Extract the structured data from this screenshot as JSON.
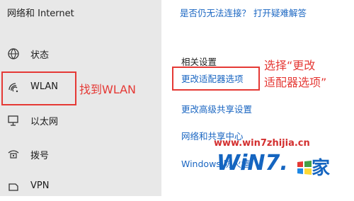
{
  "sidebar": {
    "title": "网络和 Internet",
    "items": [
      {
        "label": "状态",
        "icon": "globe-icon"
      },
      {
        "label": "WLAN",
        "icon": "wifi-icon"
      },
      {
        "label": "以太网",
        "icon": "ethernet-icon"
      },
      {
        "label": "拨号",
        "icon": "dialup-icon"
      },
      {
        "label": "VPN",
        "icon": "vpn-icon"
      }
    ]
  },
  "main": {
    "help_link": "是否仍无法连接？ 打开疑难解答",
    "related_heading": "相关设置",
    "links": {
      "adapter": "更改适配器选项",
      "advanced_sharing": "更改高级共享设置",
      "sharing_center": "网络和共享中心",
      "firewall": "Windows 防火墙"
    }
  },
  "annotations": {
    "find_wlan": "找到WLAN",
    "choose_line1": "选择“更改",
    "choose_line2": "适配器选项”"
  },
  "watermark": {
    "url": "www.win7zhijia.cn",
    "logo_text": "WiN7.",
    "logo_zh": "家"
  },
  "colors": {
    "sidebar_bg": "#e8e8e8",
    "link": "#1a66c2",
    "annotation_red": "#e53935"
  }
}
